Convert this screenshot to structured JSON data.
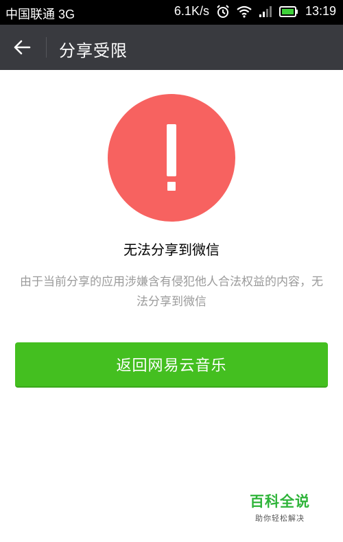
{
  "status_bar": {
    "carrier": "中国联通 3G",
    "speed": "6.1K/s",
    "time": "13:19",
    "icons": [
      "alarm-icon",
      "wifi-icon",
      "signal-icon",
      "battery-icon"
    ]
  },
  "app_bar": {
    "back_icon": "back-arrow-icon",
    "title": "分享受限"
  },
  "main": {
    "warning_icon": "exclamation-icon",
    "title": "无法分享到微信",
    "description": "由于当前分享的应用涉嫌含有侵犯他人合法权益的内容，无法分享到微信",
    "button_label": "返回网易云音乐"
  },
  "watermark": {
    "brand": "百科全说",
    "slogan": "助你轻松解决"
  },
  "colors": {
    "status_bar_bg": "#000000",
    "app_bar_bg": "#393a3f",
    "warning_red": "#f76260",
    "button_green": "#44bf20",
    "description_gray": "#9b9b9b",
    "watermark_green": "#2fb43a"
  }
}
